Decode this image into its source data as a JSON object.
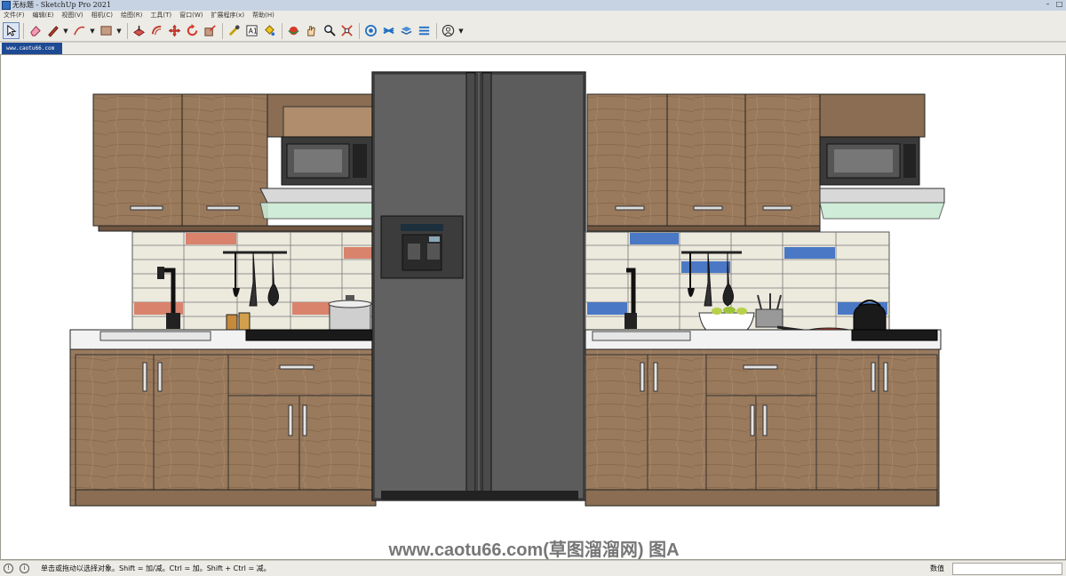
{
  "window": {
    "title": "无标题 - SketchUp Pro 2021",
    "controls": [
      "–",
      "□"
    ]
  },
  "menu": {
    "items": [
      "文件(F)",
      "编辑(E)",
      "视图(V)",
      "相机(C)",
      "绘图(R)",
      "工具(T)",
      "窗口(W)",
      "扩展程序(x)",
      "帮助(H)"
    ]
  },
  "toolbar": {
    "tools": [
      {
        "name": "select-icon"
      },
      {
        "name": "eraser-icon"
      },
      {
        "name": "line-pencil-icon"
      },
      {
        "name": "arc-icon"
      },
      {
        "name": "rectangle-shape-icon"
      },
      {
        "name": "push-pull-icon"
      },
      {
        "name": "offset-icon"
      },
      {
        "name": "move-icon"
      },
      {
        "name": "rotate-icon"
      },
      {
        "name": "scale-icon"
      },
      {
        "name": "tape-measure-icon"
      },
      {
        "name": "text-icon"
      },
      {
        "name": "paint-bucket-icon"
      },
      {
        "name": "orbit-icon"
      },
      {
        "name": "pan-icon"
      },
      {
        "name": "zoom-icon"
      },
      {
        "name": "zoom-extents-icon"
      },
      {
        "name": "warehouse-icon"
      },
      {
        "name": "extension-warehouse-icon"
      },
      {
        "name": "layout-icon"
      },
      {
        "name": "styles-icon"
      },
      {
        "name": "account-icon"
      }
    ]
  },
  "scene": {
    "tab_label": "www.caotu66.com"
  },
  "viewport": {
    "watermark": "www.caotu66.com(草图溜溜网) 图A"
  },
  "status": {
    "hint": "单击或拖动以选择对象。Shift = 加/减。Ctrl = 加。Shift + Ctrl = 减。",
    "measurements_label": "数值",
    "measurements_value": ""
  },
  "colors": {
    "wood": "#9a7a5c",
    "fridge": "#5b5b5b",
    "tile": "#ece9dd",
    "tile_red": "#d9836c",
    "tile_blue": "#4a78c4"
  }
}
